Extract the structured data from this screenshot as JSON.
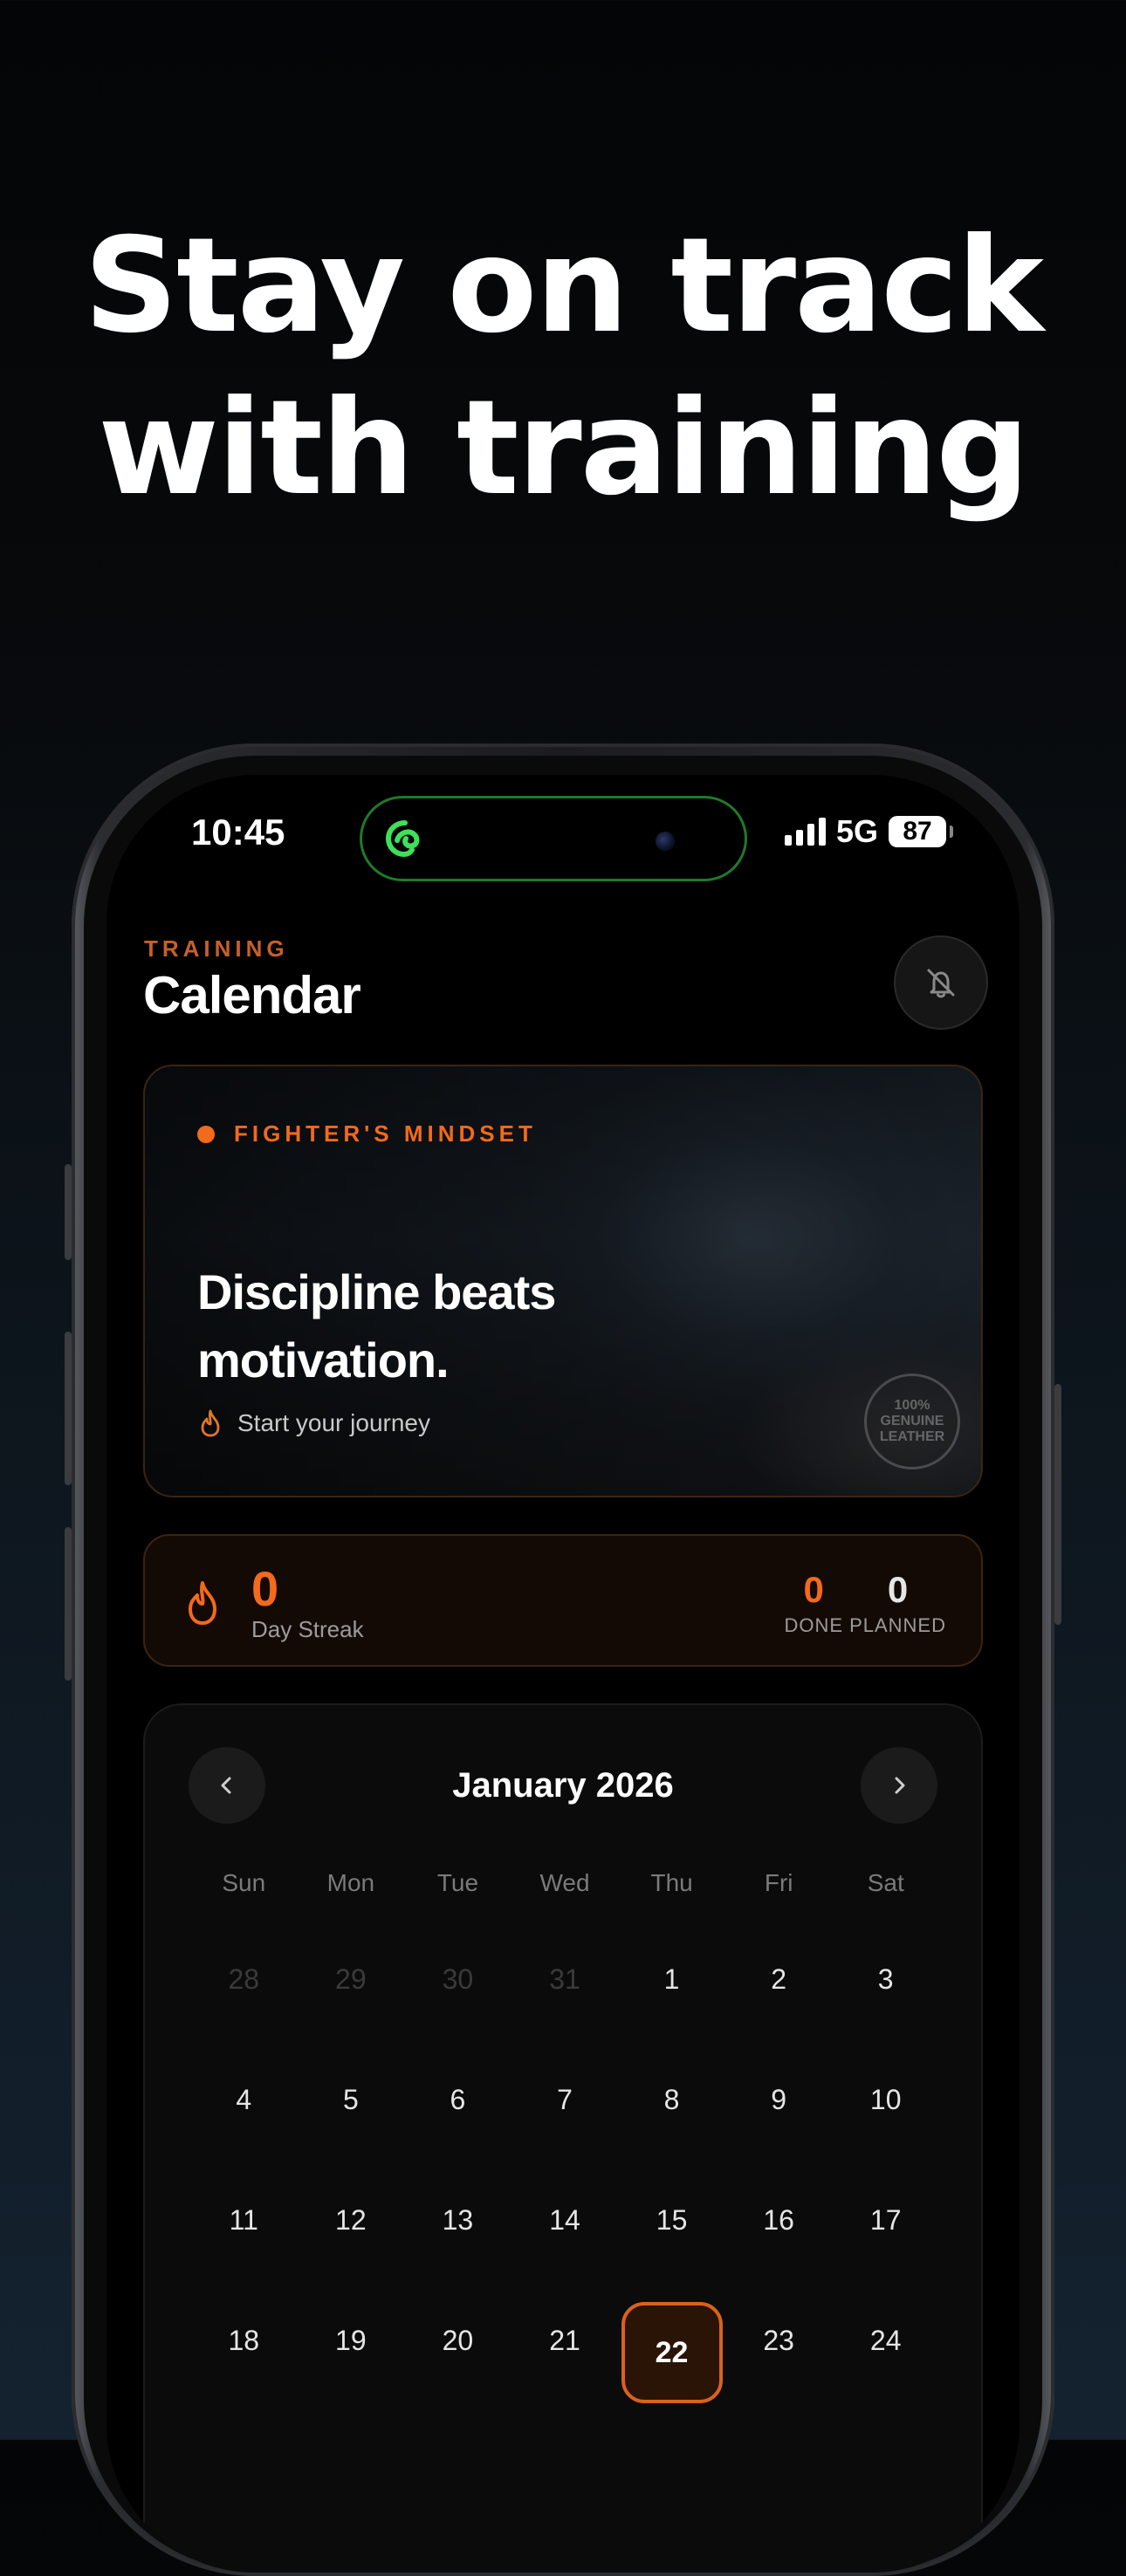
{
  "headline": {
    "line1": "Stay on track",
    "line2": "with training"
  },
  "status_bar": {
    "time": "10:45",
    "network": "5G",
    "battery": "87"
  },
  "header": {
    "eyebrow": "TRAINING",
    "title": "Calendar",
    "bell_icon": "bell-off-icon"
  },
  "hero": {
    "eyebrow": "FIGHTER'S MINDSET",
    "quote_line1": "Discipline beats",
    "quote_line2": "motivation.",
    "subtitle": "Start your journey",
    "badge": "100% GENUINE LEATHER"
  },
  "streak": {
    "count": "0",
    "label": "Day Streak",
    "done_value": "0",
    "done_label": "DONE",
    "planned_value": "0",
    "planned_label": "PLANNED"
  },
  "calendar": {
    "month": "January 2026",
    "weekdays": [
      "Sun",
      "Mon",
      "Tue",
      "Wed",
      "Thu",
      "Fri",
      "Sat"
    ],
    "weeks": [
      [
        "28",
        "29",
        "30",
        "31",
        "1",
        "2",
        "3"
      ],
      [
        "4",
        "5",
        "6",
        "7",
        "8",
        "9",
        "10"
      ],
      [
        "11",
        "12",
        "13",
        "14",
        "15",
        "16",
        "17"
      ],
      [
        "18",
        "19",
        "20",
        "21",
        "22",
        "23",
        "24"
      ]
    ],
    "muted_days": [
      "28",
      "29",
      "30",
      "31"
    ],
    "selected_day": "22"
  },
  "colors": {
    "accent": "#f26a1b",
    "island_border": "#1f7a2a",
    "background": "#000000"
  }
}
